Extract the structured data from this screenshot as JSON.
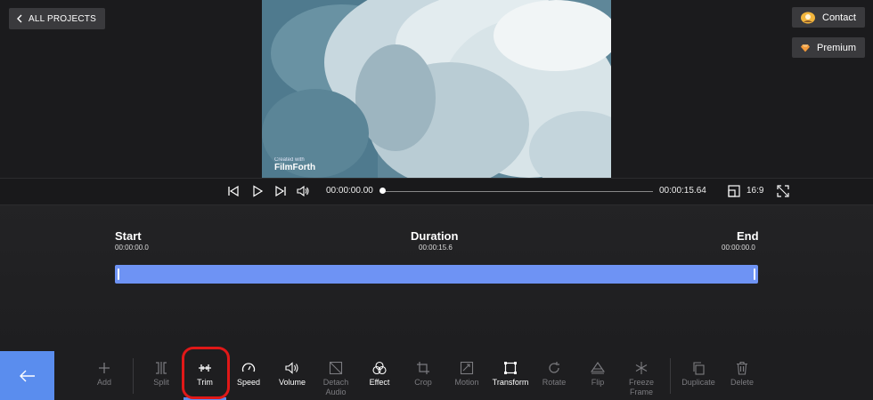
{
  "header": {
    "all_projects": "ALL PROJECTS",
    "contact": "Contact",
    "premium": "Premium"
  },
  "preview": {
    "watermark_small": "Created with",
    "watermark_brand": "FilmForth"
  },
  "playback": {
    "current_time": "00:00:00.00",
    "total_time": "00:00:15.64",
    "aspect_ratio": "16:9",
    "progress": 0
  },
  "trim": {
    "start_label": "Start",
    "start_value": "00:00:00.0",
    "duration_label": "Duration",
    "duration_value": "00:00:15.6",
    "end_label": "End",
    "end_value": "00:00:00.0"
  },
  "toolbar": {
    "items": [
      {
        "label": "Add",
        "icon": "plus-icon",
        "enabled": false
      },
      {
        "label": "Split",
        "icon": "split-icon",
        "enabled": false
      },
      {
        "label": "Trim",
        "icon": "trim-icon",
        "enabled": true,
        "selected": true
      },
      {
        "label": "Speed",
        "icon": "speedometer-icon",
        "enabled": true
      },
      {
        "label": "Volume",
        "icon": "speaker-icon",
        "enabled": true
      },
      {
        "label": "Detach\nAudio",
        "icon": "detach-audio-icon",
        "enabled": false
      },
      {
        "label": "Effect",
        "icon": "effect-icon",
        "enabled": true
      },
      {
        "label": "Crop",
        "icon": "crop-icon",
        "enabled": false
      },
      {
        "label": "Motion",
        "icon": "motion-icon",
        "enabled": false
      },
      {
        "label": "Transform",
        "icon": "transform-icon",
        "enabled": true
      },
      {
        "label": "Rotate",
        "icon": "rotate-icon",
        "enabled": false
      },
      {
        "label": "Flip",
        "icon": "flip-icon",
        "enabled": false
      },
      {
        "label": "Freeze\nFrame",
        "icon": "snowflake-icon",
        "enabled": false
      },
      {
        "label": "Duplicate",
        "icon": "duplicate-icon",
        "enabled": false
      },
      {
        "label": "Delete",
        "icon": "trash-icon",
        "enabled": false
      }
    ]
  },
  "colors": {
    "accent": "#5a8dee",
    "trim_bar": "#6e93f4",
    "highlight": "#e01818"
  }
}
